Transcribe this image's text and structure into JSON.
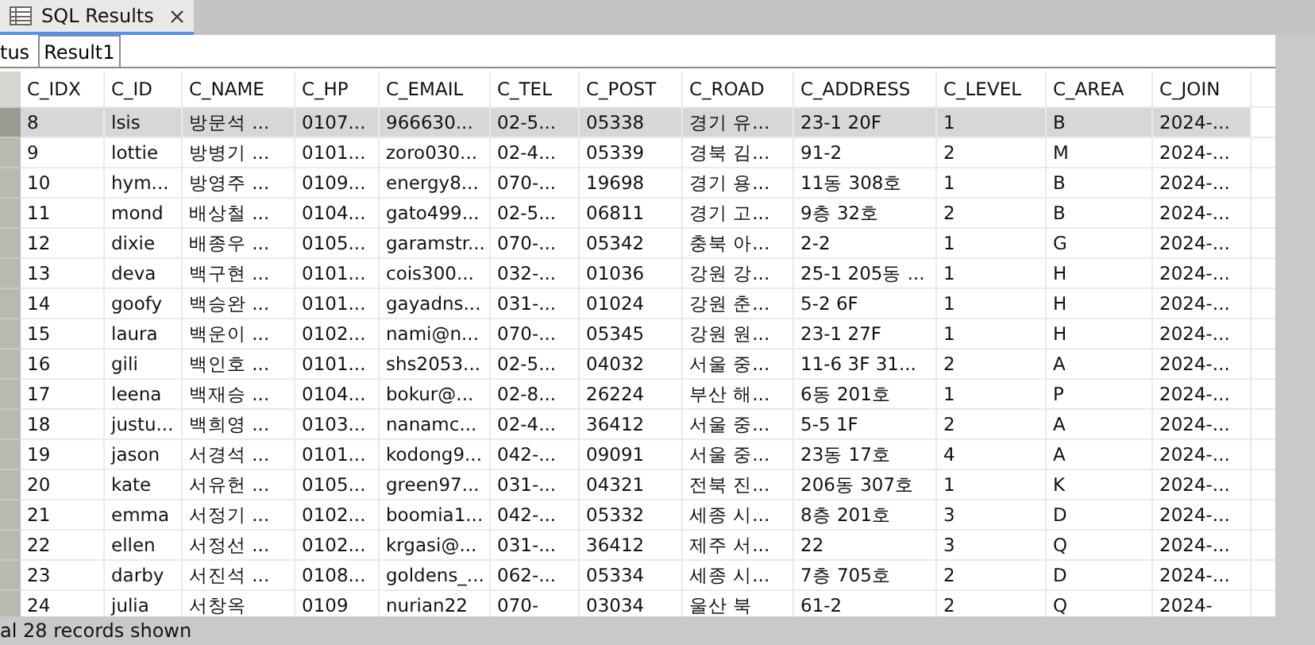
{
  "editor_tabs": [
    {
      "label": "SQL Results",
      "selected": true
    }
  ],
  "result_tabs": [
    {
      "label": "tus",
      "selected": false
    },
    {
      "label": "Result1",
      "selected": true
    }
  ],
  "table": {
    "columns": [
      "C_IDX",
      "C_ID",
      "C_NAME",
      "C_HP",
      "C_EMAIL",
      "C_TEL",
      "C_POST",
      "C_ROAD",
      "C_ADDRESS",
      "C_LEVEL",
      "C_AREA",
      "C_JOIN"
    ],
    "rows": [
      {
        "selected": true,
        "cells": [
          "8",
          "lsis",
          "방문석 ...",
          "0107...",
          "966630...",
          "02-5...",
          "05338",
          "경기 유...",
          "23-1 20F",
          "1",
          "B",
          "2024-..."
        ]
      },
      {
        "selected": false,
        "cells": [
          "9",
          "lottie",
          "방병기 ...",
          "0101...",
          "zoro030...",
          "02-4...",
          "05339",
          "경북 김...",
          "91-2",
          "2",
          "M",
          "2024-..."
        ]
      },
      {
        "selected": false,
        "cells": [
          "10",
          "hym...",
          "방영주 ...",
          "0109...",
          "energy8...",
          "070-...",
          "19698",
          "경기 용...",
          "11동 308호",
          "1",
          "B",
          "2024-..."
        ]
      },
      {
        "selected": false,
        "cells": [
          "11",
          "mond",
          "배상철 ...",
          "0104...",
          "gato499...",
          "02-5...",
          "06811",
          "경기 고...",
          "9층 32호",
          "2",
          "B",
          "2024-..."
        ]
      },
      {
        "selected": false,
        "cells": [
          "12",
          "dixie",
          "배종우 ...",
          "0105...",
          "garamstr...",
          "070-...",
          "05342",
          "충북 아...",
          "2-2",
          "1",
          "G",
          "2024-..."
        ]
      },
      {
        "selected": false,
        "cells": [
          "13",
          "deva",
          "백구현 ...",
          "0101...",
          "cois300...",
          "032-...",
          "01036",
          "강원 강...",
          "25-1 205동 ...",
          "1",
          "H",
          "2024-..."
        ]
      },
      {
        "selected": false,
        "cells": [
          "14",
          "goofy",
          "백승완 ...",
          "0101...",
          "gayadns...",
          "031-...",
          "01024",
          "강원 춘...",
          "5-2 6F",
          "1",
          "H",
          "2024-..."
        ]
      },
      {
        "selected": false,
        "cells": [
          "15",
          "laura",
          "백운이 ...",
          "0102...",
          "nami@n...",
          "070-...",
          "05345",
          "강원 원...",
          "23-1 27F",
          "1",
          "H",
          "2024-..."
        ]
      },
      {
        "selected": false,
        "cells": [
          "16",
          "gili",
          "백인호 ...",
          "0101...",
          "shs2053...",
          "02-5...",
          "04032",
          "서울 중...",
          "11-6 3F 31...",
          "2",
          "A",
          "2024-..."
        ]
      },
      {
        "selected": false,
        "cells": [
          "17",
          "leena",
          "백재승 ...",
          "0104...",
          "bokur@...",
          "02-8...",
          "26224",
          "부산 해...",
          "6동 201호",
          "1",
          "P",
          "2024-..."
        ]
      },
      {
        "selected": false,
        "cells": [
          "18",
          "justu...",
          "백희영 ...",
          "0103...",
          "nanamc...",
          "02-4...",
          "36412",
          "서울 중...",
          "5-5 1F",
          "2",
          "A",
          "2024-..."
        ]
      },
      {
        "selected": false,
        "cells": [
          "19",
          "jason",
          "서경석 ...",
          "0101...",
          "kodong9...",
          "042-...",
          "09091",
          "서울 중...",
          "23동 17호",
          "4",
          "A",
          "2024-..."
        ]
      },
      {
        "selected": false,
        "cells": [
          "20",
          "kate",
          "서유헌 ...",
          "0105...",
          "green97...",
          "031-...",
          "04321",
          "전북 진...",
          "206동 307호",
          "1",
          "K",
          "2024-..."
        ]
      },
      {
        "selected": false,
        "cells": [
          "21",
          "emma",
          "서정기 ...",
          "0102...",
          "boomia1...",
          "042-...",
          "05332",
          "세종 시...",
          "8층 201호",
          "3",
          "D",
          "2024-..."
        ]
      },
      {
        "selected": false,
        "cells": [
          "22",
          "ellen",
          "서정선 ...",
          "0102...",
          "krgasi@...",
          "031-...",
          "36412",
          "제주 서...",
          "22",
          "3",
          "Q",
          "2024-..."
        ]
      },
      {
        "selected": false,
        "cells": [
          "23",
          "darby",
          "서진석 ...",
          "0108...",
          "goldens_...",
          "062-...",
          "05334",
          "세종 시...",
          "7층 705호",
          "2",
          "D",
          "2024-..."
        ]
      },
      {
        "selected": false,
        "cells": [
          "24",
          "julia",
          "서창옥",
          "0109",
          "nurian22",
          "070-",
          "03034",
          "울산 북",
          "61-2",
          "2",
          "Q",
          "2024-"
        ]
      }
    ]
  },
  "status_bar": "al 28 records shown"
}
